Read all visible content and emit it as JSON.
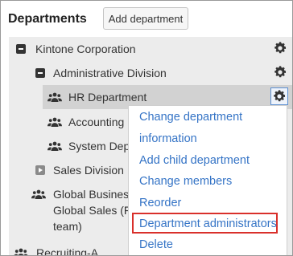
{
  "header": {
    "title": "Departments",
    "add_button": "Add department"
  },
  "tree": {
    "rows": [
      {
        "label": "Kintone Corporation",
        "icon": "collapse-icon"
      },
      {
        "label": "Administrative Division",
        "icon": "collapse-icon"
      },
      {
        "label": "HR Department",
        "icon": "people-icon"
      },
      {
        "label": "Accounting",
        "icon": "people-icon"
      },
      {
        "label": "System Dep",
        "icon": "people-icon"
      },
      {
        "label": "Sales Division",
        "icon": "expand-icon"
      },
      {
        "label": "Global Busines",
        "icon": "people-icon"
      },
      {
        "label": "Global Sales (F",
        "icon": "none"
      },
      {
        "label": "team)",
        "icon": "none"
      },
      {
        "label": "Recruiting-A",
        "icon": "people-icon"
      }
    ]
  },
  "menu": {
    "items": [
      "Change department",
      "information",
      "Add child department",
      "Change members",
      "Reorder",
      "Department administrators",
      "Delete"
    ]
  },
  "colors": {
    "link": "#3574c6",
    "highlight_border": "#d9302b",
    "selected_row": "#d2d2d2",
    "tree_bg": "#ececec"
  }
}
